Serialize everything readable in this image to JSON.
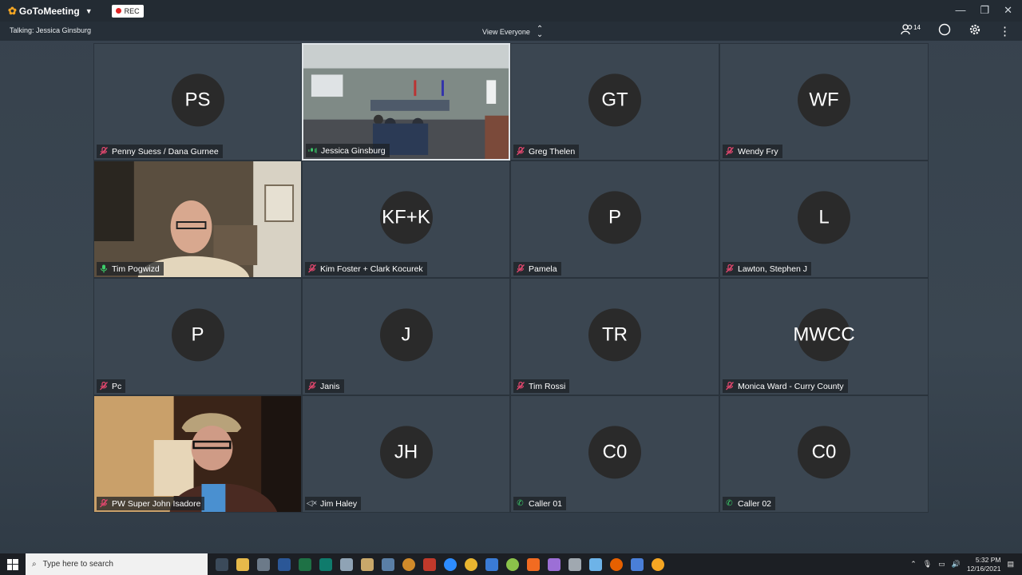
{
  "app": {
    "name": "GoToMeeting",
    "rec_label": "REC"
  },
  "subbar": {
    "talking": "Talking: Jessica Ginsburg",
    "view": "View Everyone",
    "participant_count": "14"
  },
  "tiles": [
    {
      "initials": "PS",
      "name": "Penny Suess  / Dana Gurnee",
      "mic": "muted",
      "type": "avatar"
    },
    {
      "initials": "",
      "name": "Jessica Ginsburg",
      "mic": "speaking",
      "type": "video-room"
    },
    {
      "initials": "GT",
      "name": "Greg Thelen",
      "mic": "muted",
      "type": "avatar"
    },
    {
      "initials": "WF",
      "name": "Wendy Fry",
      "mic": "muted",
      "type": "avatar"
    },
    {
      "initials": "",
      "name": "Tim  Pogwizd",
      "mic": "live",
      "type": "video-person1"
    },
    {
      "initials": "KF+K",
      "name": "Kim Foster + Clark Kocurek",
      "mic": "muted",
      "type": "avatar"
    },
    {
      "initials": "P",
      "name": "Pamela",
      "mic": "muted",
      "type": "avatar"
    },
    {
      "initials": "L",
      "name": "Lawton, Stephen J",
      "mic": "muted",
      "type": "avatar"
    },
    {
      "initials": "P",
      "name": "Pc",
      "mic": "muted",
      "type": "avatar"
    },
    {
      "initials": "J",
      "name": "Janis",
      "mic": "muted",
      "type": "avatar"
    },
    {
      "initials": "TR",
      "name": "Tim Rossi",
      "mic": "muted",
      "type": "avatar"
    },
    {
      "initials": "MWCC",
      "name": "Monica Ward - Curry County",
      "mic": "muted",
      "type": "avatar"
    },
    {
      "initials": "",
      "name": "PW Super John Isadore",
      "mic": "muted",
      "type": "video-person2"
    },
    {
      "initials": "JH",
      "name": "Jim Haley",
      "mic": "speaker-off",
      "type": "avatar"
    },
    {
      "initials": "C0",
      "name": "Caller 01",
      "mic": "phone",
      "type": "avatar"
    },
    {
      "initials": "C0",
      "name": "Caller 02",
      "mic": "phone",
      "type": "avatar"
    }
  ],
  "taskbar": {
    "search_placeholder": "Type here to search",
    "time": "5:32 PM",
    "date": "12/16/2021"
  },
  "colors": {
    "accent_orange": "#f5a623",
    "muted_red": "#e0476d",
    "live_green": "#3ccf6a"
  }
}
